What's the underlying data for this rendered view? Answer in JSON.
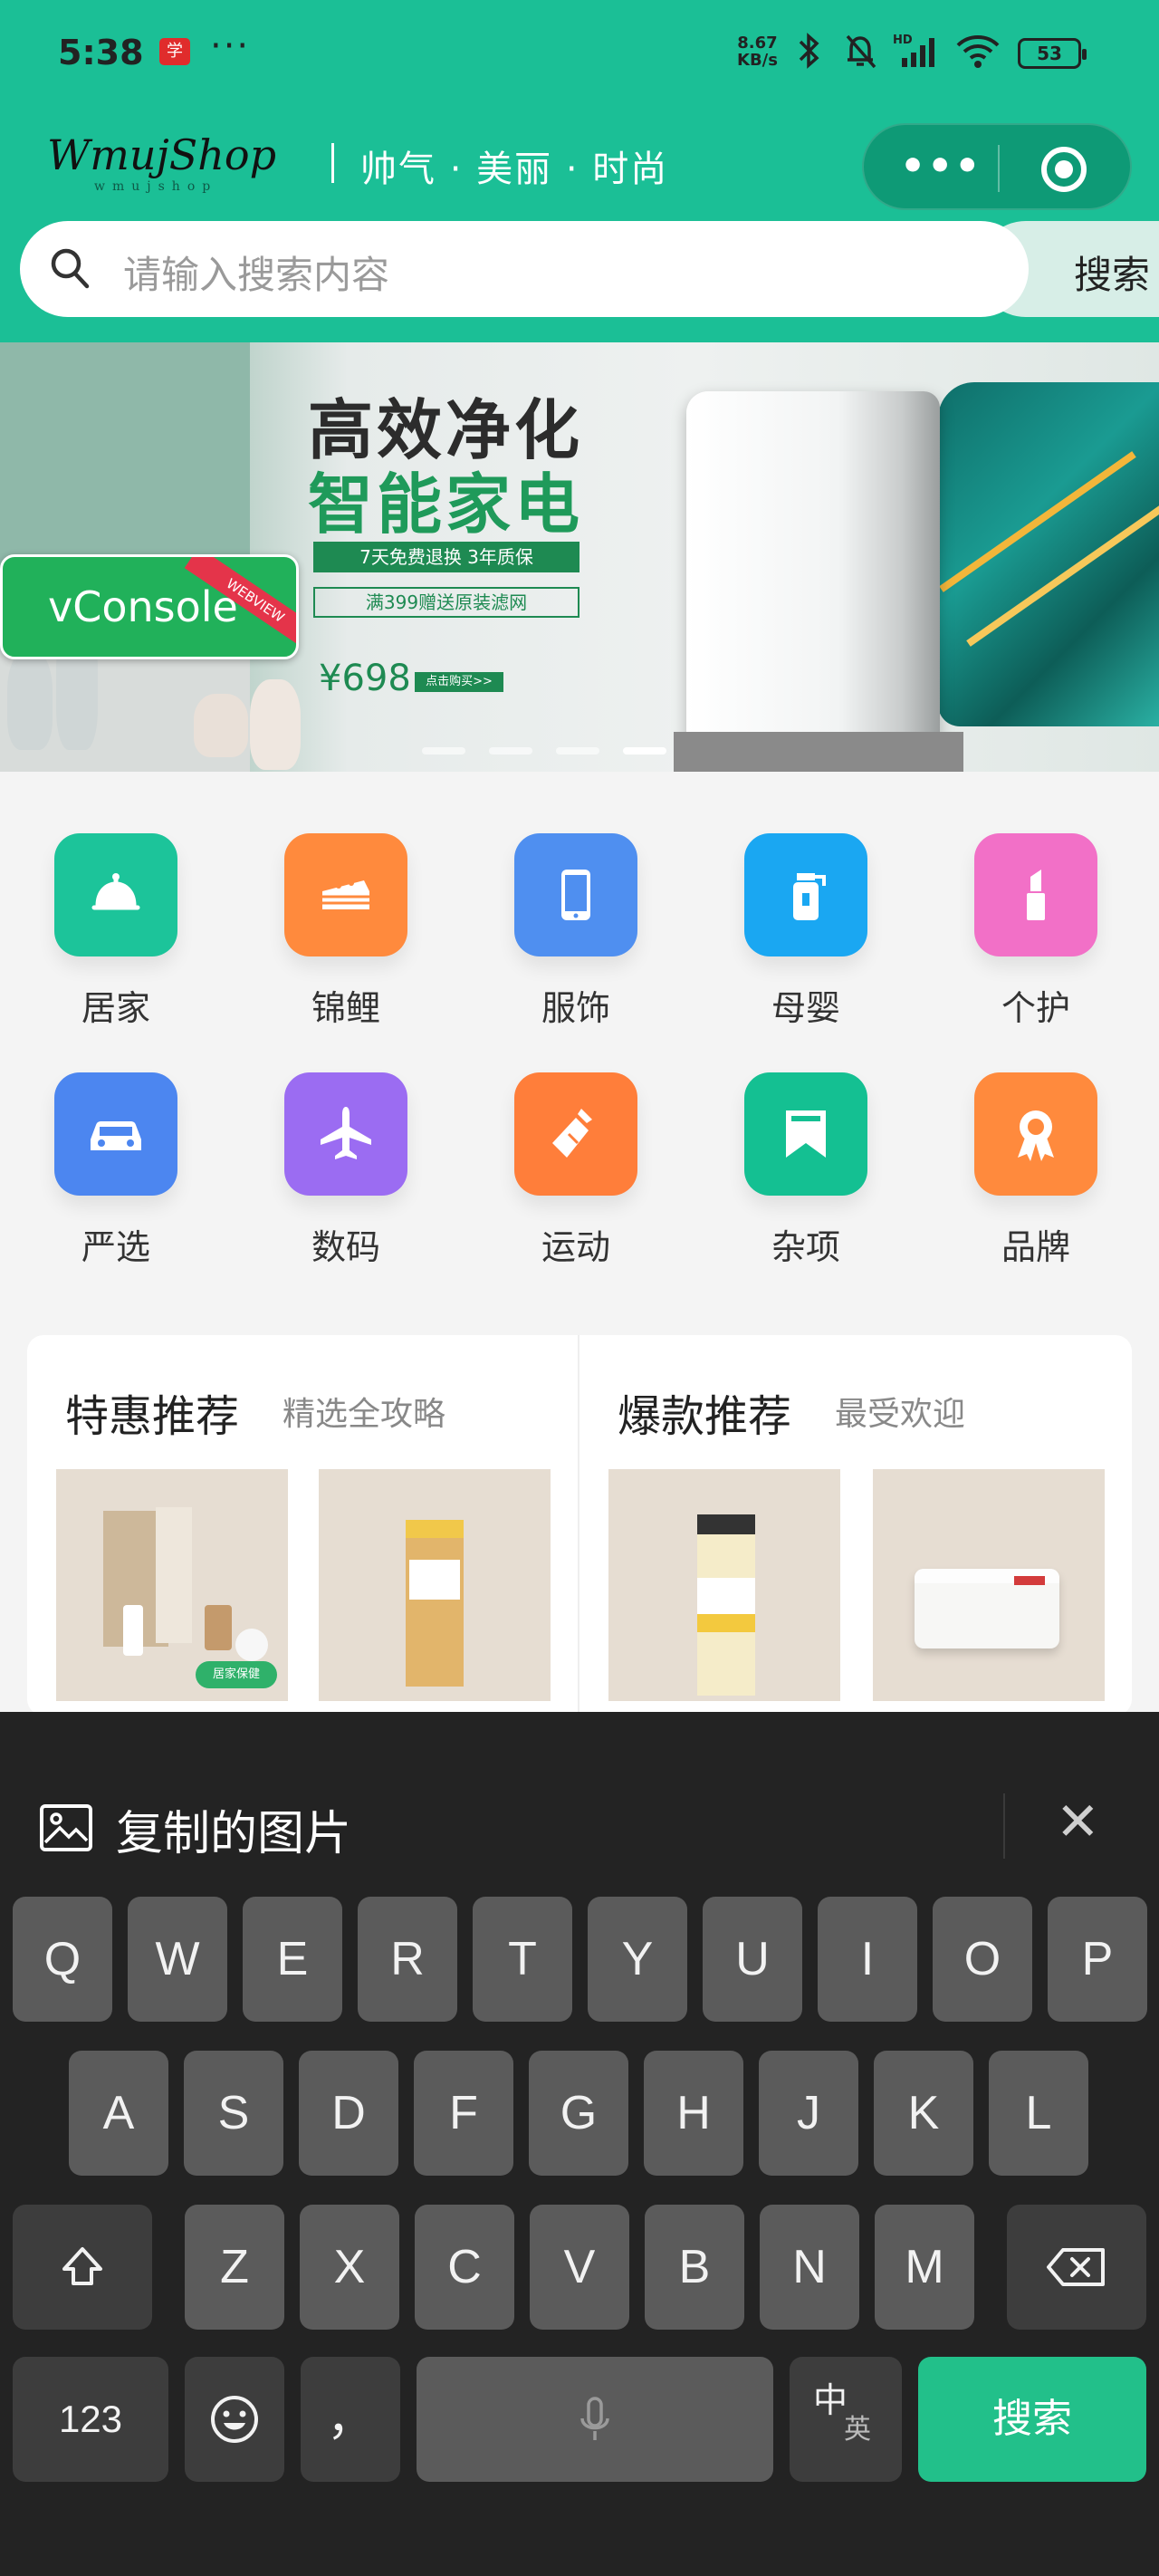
{
  "status_bar": {
    "time": "5:38",
    "app_badge": "学",
    "more": "···",
    "speed_value": "8.67",
    "speed_unit": "KB/s",
    "battery": "53"
  },
  "header": {
    "logo": "WmujShop",
    "logo_sub": "wmujshop",
    "slogan": "帅气 · 美丽 · 时尚",
    "capsule_more": "•••"
  },
  "search": {
    "placeholder": "请输入搜索内容",
    "button": "搜索"
  },
  "banner": {
    "title_line1": "高效净化",
    "title_line2": "智能家电",
    "tag1": "7天免费退换 3年质保",
    "tag2": "满399赠送原装滤网",
    "price": "¥698",
    "buy": "点击购买>>",
    "slides": 4,
    "active_slide": 4
  },
  "vconsole": {
    "label": "vConsole",
    "ribbon": "WEBVIEW"
  },
  "categories": [
    {
      "label": "居家",
      "icon": "cloche-icon",
      "color": "#1cc49a"
    },
    {
      "label": "锦鲤",
      "icon": "cake-icon",
      "color": "#ff8a3d"
    },
    {
      "label": "服饰",
      "icon": "phone-icon",
      "color": "#4f8ff0"
    },
    {
      "label": "母婴",
      "icon": "bottle-icon",
      "color": "#1aa7f2"
    },
    {
      "label": "个护",
      "icon": "lipstick-icon",
      "color": "#f270c7"
    },
    {
      "label": "严选",
      "icon": "car-icon",
      "color": "#4c86f0"
    },
    {
      "label": "数码",
      "icon": "airplane-icon",
      "color": "#9b6cf2"
    },
    {
      "label": "运动",
      "icon": "sport-bottle-icon",
      "color": "#ff7e3a"
    },
    {
      "label": "杂项",
      "icon": "bookmark-icon",
      "color": "#14c092"
    },
    {
      "label": "品牌",
      "icon": "award-icon",
      "color": "#ff8a3d"
    }
  ],
  "recommend": {
    "left": {
      "title": "特惠推荐",
      "subtitle": "精选全攻略",
      "badge": "居家保健"
    },
    "right": {
      "title": "爆款推荐",
      "subtitle": "最受欢迎"
    }
  },
  "keyboard": {
    "clipboard_label": "复制的图片",
    "row1": [
      "Q",
      "W",
      "E",
      "R",
      "T",
      "Y",
      "U",
      "I",
      "O",
      "P"
    ],
    "row2": [
      "A",
      "S",
      "D",
      "F",
      "G",
      "H",
      "J",
      "K",
      "L"
    ],
    "row3": [
      "Z",
      "X",
      "C",
      "V",
      "B",
      "N",
      "M"
    ],
    "num_key": "123",
    "punct_key": "，",
    "lang_key": "中",
    "lang_sub": "英",
    "action_key": "搜索"
  }
}
